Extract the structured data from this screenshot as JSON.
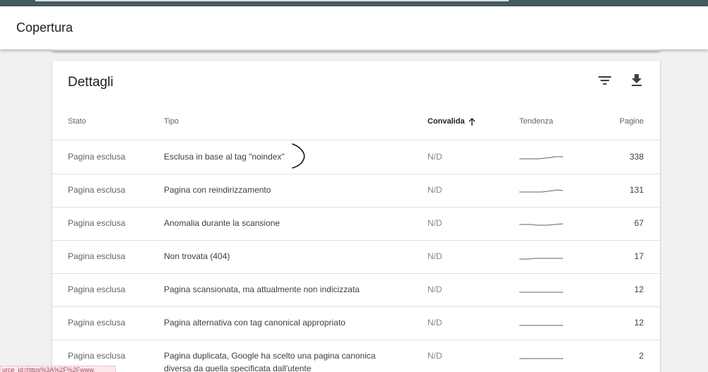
{
  "header": {
    "title": "Copertura"
  },
  "details": {
    "title": "Dettagli",
    "columns": {
      "stato": "Stato",
      "tipo": "Tipo",
      "convalida": "Convalida",
      "tendenza": "Tendenza",
      "pagine": "Pagine"
    },
    "rows": [
      {
        "stato": "Pagina esclusa",
        "tipo": "Esclusa in base al tag \"noindex\"",
        "convalida": "N/D",
        "pagine": "338"
      },
      {
        "stato": "Pagina esclusa",
        "tipo": "Pagina con reindirizzamento",
        "convalida": "N/D",
        "pagine": "131"
      },
      {
        "stato": "Pagina esclusa",
        "tipo": "Anomalia durante la scansione",
        "convalida": "N/D",
        "pagine": "67"
      },
      {
        "stato": "Pagina esclusa",
        "tipo": "Non trovata (404)",
        "convalida": "N/D",
        "pagine": "17"
      },
      {
        "stato": "Pagina esclusa",
        "tipo": "Pagina scansionata, ma attualmente non indicizzata",
        "convalida": "N/D",
        "pagine": "12"
      },
      {
        "stato": "Pagina esclusa",
        "tipo": "Pagina alternativa con tag canonical appropriato",
        "convalida": "N/D",
        "pagine": "12"
      },
      {
        "stato": "Pagina esclusa",
        "tipo": "Pagina duplicata, Google ha scelto una pagina canonica diversa da quella specificata dall'utente",
        "convalida": "N/D",
        "pagine": "2"
      }
    ]
  },
  "status_bar": {
    "url": "urce_id=https%3A%2F%2Fwww."
  },
  "icons": {
    "filter": "filter-icon",
    "download": "download-icon",
    "sort": "arrow-up-icon"
  },
  "colors": {
    "top_bar": "#465a64",
    "text_primary": "#202124",
    "text_secondary": "#5f6368",
    "divider": "#e0e0e0"
  }
}
